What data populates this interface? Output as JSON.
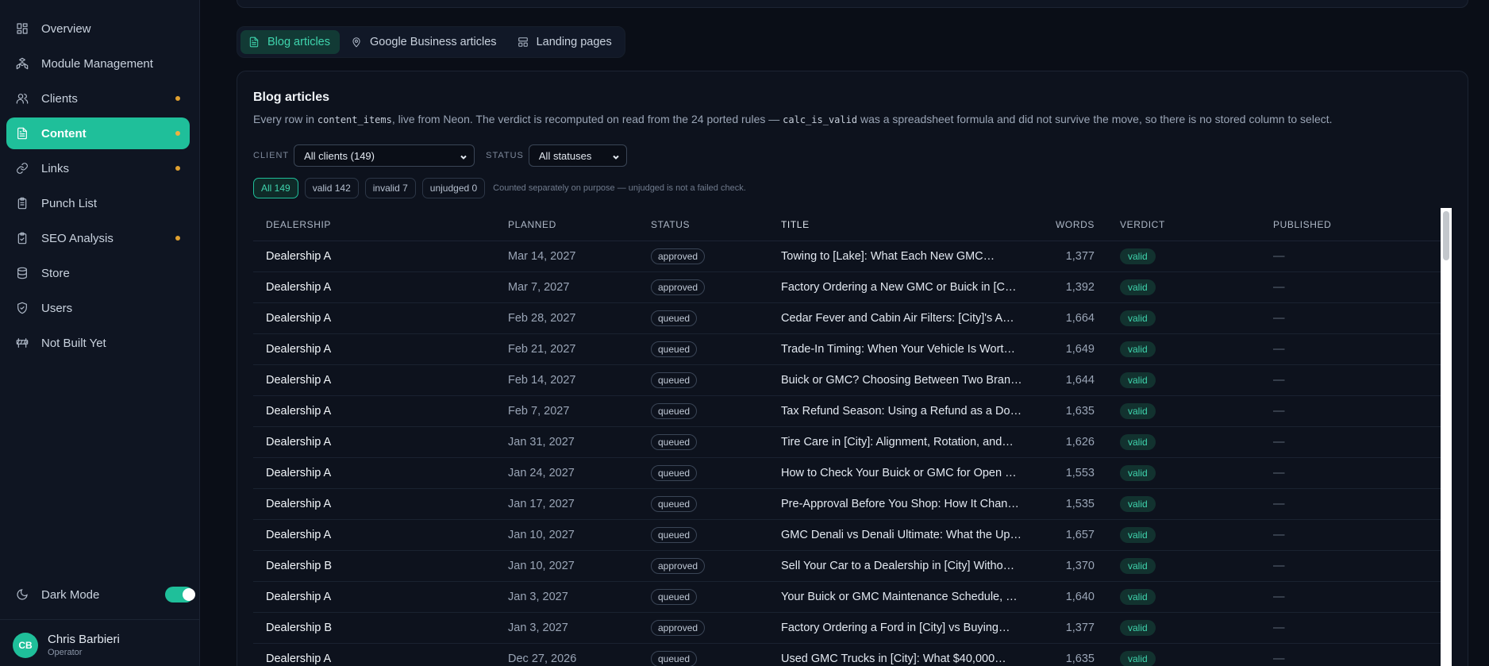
{
  "sidebar": {
    "items": [
      {
        "label": "Overview",
        "icon": "grid-icon",
        "dot": false,
        "active": false
      },
      {
        "label": "Module Management",
        "icon": "modules-icon",
        "dot": false,
        "active": false
      },
      {
        "label": "Clients",
        "icon": "users-icon",
        "dot": true,
        "active": false
      },
      {
        "label": "Content",
        "icon": "document-icon",
        "dot": true,
        "active": true
      },
      {
        "label": "Links",
        "icon": "link-icon",
        "dot": true,
        "active": false
      },
      {
        "label": "Punch List",
        "icon": "clipboard-icon",
        "dot": false,
        "active": false
      },
      {
        "label": "SEO Analysis",
        "icon": "clipboard-check-icon",
        "dot": true,
        "active": false
      },
      {
        "label": "Store",
        "icon": "database-icon",
        "dot": false,
        "active": false
      },
      {
        "label": "Users",
        "icon": "shield-icon",
        "dot": false,
        "active": false
      },
      {
        "label": "Not Built Yet",
        "icon": "barrier-icon",
        "dot": false,
        "active": false
      }
    ],
    "dark_mode_label": "Dark Mode",
    "user": {
      "initials": "CB",
      "name": "Chris Barbieri",
      "role": "Operator"
    }
  },
  "tabs": [
    {
      "label": "Blog articles",
      "icon": "document-icon",
      "active": true
    },
    {
      "label": "Google Business articles",
      "icon": "map-pin-icon",
      "active": false
    },
    {
      "label": "Landing pages",
      "icon": "layout-icon",
      "active": false
    }
  ],
  "panel": {
    "title": "Blog articles",
    "desc_1": "Every row in ",
    "desc_code_1": "content_items",
    "desc_2": ", live from Neon. The verdict is recomputed on read from the 24 ported rules — ",
    "desc_code_2": "calc_is_valid",
    "desc_3": " was a spreadsheet formula and did not survive the move, so there is no stored column to select."
  },
  "filters": {
    "client_label": "CLIENT",
    "client_value": "All clients (149)",
    "status_label": "STATUS",
    "status_value": "All statuses"
  },
  "pills": [
    {
      "label": "All 149",
      "active": true
    },
    {
      "label": "valid 142",
      "active": false
    },
    {
      "label": "invalid 7",
      "active": false
    },
    {
      "label": "unjudged 0",
      "active": false
    }
  ],
  "pill_note": "Counted separately on purpose — unjudged is not a failed check.",
  "table": {
    "headers": [
      "DEALERSHIP",
      "PLANNED",
      "STATUS",
      "TITLE",
      "WORDS",
      "VERDICT",
      "PUBLISHED"
    ],
    "rows": [
      {
        "dealership": "Dealership A",
        "planned": "Mar 14, 2027",
        "status": "approved",
        "title": "Towing to [Lake]: What Each New GMC…",
        "words": "1,377",
        "verdict": "valid",
        "published": "—"
      },
      {
        "dealership": "Dealership A",
        "planned": "Mar 7, 2027",
        "status": "approved",
        "title": "Factory Ordering a New GMC or Buick in [C…",
        "words": "1,392",
        "verdict": "valid",
        "published": "—"
      },
      {
        "dealership": "Dealership A",
        "planned": "Feb 28, 2027",
        "status": "queued",
        "title": "Cedar Fever and Cabin Air Filters: [City]'s A…",
        "words": "1,664",
        "verdict": "valid",
        "published": "—"
      },
      {
        "dealership": "Dealership A",
        "planned": "Feb 21, 2027",
        "status": "queued",
        "title": "Trade-In Timing: When Your Vehicle Is Wort…",
        "words": "1,649",
        "verdict": "valid",
        "published": "—"
      },
      {
        "dealership": "Dealership A",
        "planned": "Feb 14, 2027",
        "status": "queued",
        "title": "Buick or GMC? Choosing Between Two Bran…",
        "words": "1,644",
        "verdict": "valid",
        "published": "—"
      },
      {
        "dealership": "Dealership A",
        "planned": "Feb 7, 2027",
        "status": "queued",
        "title": "Tax Refund Season: Using a Refund as a Do…",
        "words": "1,635",
        "verdict": "valid",
        "published": "—"
      },
      {
        "dealership": "Dealership A",
        "planned": "Jan 31, 2027",
        "status": "queued",
        "title": "Tire Care in [City]: Alignment, Rotation, and…",
        "words": "1,626",
        "verdict": "valid",
        "published": "—"
      },
      {
        "dealership": "Dealership A",
        "planned": "Jan 24, 2027",
        "status": "queued",
        "title": "How to Check Your Buick or GMC for Open …",
        "words": "1,553",
        "verdict": "valid",
        "published": "—"
      },
      {
        "dealership": "Dealership A",
        "planned": "Jan 17, 2027",
        "status": "queued",
        "title": "Pre-Approval Before You Shop: How It Chan…",
        "words": "1,535",
        "verdict": "valid",
        "published": "—"
      },
      {
        "dealership": "Dealership A",
        "planned": "Jan 10, 2027",
        "status": "queued",
        "title": "GMC Denali vs Denali Ultimate: What the Up…",
        "words": "1,657",
        "verdict": "valid",
        "published": "—"
      },
      {
        "dealership": "Dealership B",
        "planned": "Jan 10, 2027",
        "status": "approved",
        "title": "Sell Your Car to a Dealership in [City] Witho…",
        "words": "1,370",
        "verdict": "valid",
        "published": "—"
      },
      {
        "dealership": "Dealership A",
        "planned": "Jan 3, 2027",
        "status": "queued",
        "title": "Your Buick or GMC Maintenance Schedule, …",
        "words": "1,640",
        "verdict": "valid",
        "published": "—"
      },
      {
        "dealership": "Dealership B",
        "planned": "Jan 3, 2027",
        "status": "approved",
        "title": "Factory Ordering a Ford in [City] vs Buying…",
        "words": "1,377",
        "verdict": "valid",
        "published": "—"
      },
      {
        "dealership": "Dealership A",
        "planned": "Dec 27, 2026",
        "status": "queued",
        "title": "Used GMC Trucks in [City]: What $40,000…",
        "words": "1,635",
        "verdict": "valid",
        "published": "—"
      }
    ]
  },
  "colors": {
    "accent": "#1fbf9a",
    "background": "#0a0e17",
    "sidebar": "#0f1522",
    "dot": "#e0a030"
  }
}
